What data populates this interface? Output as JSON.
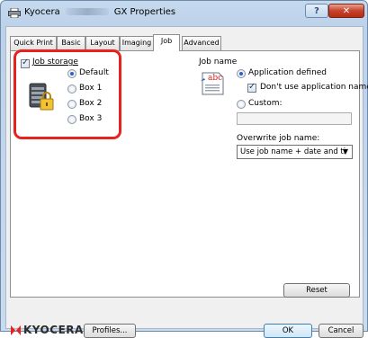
{
  "window": {
    "title_prefix": "Kyocera",
    "title_suffix": "GX Properties",
    "help_label": "?",
    "close_label": "✕"
  },
  "tabs": [
    {
      "label": "Quick Print",
      "active": false
    },
    {
      "label": "Basic",
      "active": false
    },
    {
      "label": "Layout",
      "active": false
    },
    {
      "label": "Imaging",
      "active": false
    },
    {
      "label": "Job",
      "active": true
    },
    {
      "label": "Advanced",
      "active": false
    }
  ],
  "job_storage": {
    "label": "Job storage",
    "checked": true,
    "options": [
      {
        "label": "Default",
        "selected": true
      },
      {
        "label": "Box 1",
        "selected": false
      },
      {
        "label": "Box 2",
        "selected": false
      },
      {
        "label": "Box 3",
        "selected": false
      }
    ]
  },
  "job_name": {
    "heading": "Job name",
    "icon_text": "abc",
    "application_defined_label": "Application defined",
    "application_defined_selected": true,
    "dont_use_app_name_label": "Don't use application name",
    "dont_use_app_name_checked": true,
    "custom_label": "Custom:",
    "custom_selected": false,
    "custom_value": "",
    "overwrite_label": "Overwrite job name:",
    "overwrite_value": "Use job name + date and ti"
  },
  "buttons": {
    "reset": "Reset",
    "profiles": "Profiles...",
    "ok": "OK",
    "cancel": "Cancel"
  },
  "brand": {
    "logo_text": "KYOCERA",
    "accent_color": "#e8221f"
  }
}
